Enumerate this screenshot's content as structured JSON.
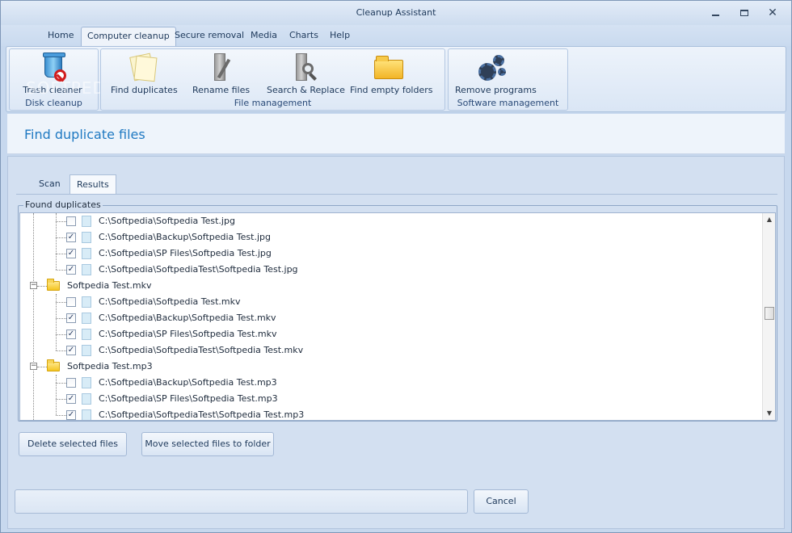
{
  "window": {
    "title": "Cleanup Assistant",
    "minimize_label": "",
    "maximize_label": "",
    "close_label": "✕"
  },
  "menu_tabs": [
    "Home",
    "Computer cleanup",
    "Secure removal",
    "Media",
    "Charts",
    "Help"
  ],
  "active_menu_tab": "Computer cleanup",
  "ribbon": {
    "disk_cleanup": {
      "label": "Disk cleanup",
      "buttons": [
        {
          "label": "Trash cleaner",
          "icon": "trash-can-icon"
        }
      ]
    },
    "file_management": {
      "label": "File management",
      "buttons": [
        {
          "label": "Find duplicates",
          "icon": "duplicate-papers-icon"
        },
        {
          "label": "Rename files",
          "icon": "rename-pen-icon"
        },
        {
          "label": "Search & Replace",
          "icon": "search-replace-icon"
        },
        {
          "label": "Find empty folders",
          "icon": "empty-folder-icon"
        }
      ]
    },
    "software_management": {
      "label": "Software management",
      "buttons": [
        {
          "label": "Remove programs",
          "icon": "gears-icon"
        }
      ]
    },
    "watermark": "SOFTPEDIA"
  },
  "page": {
    "title": "Find duplicate files"
  },
  "sub_tabs": [
    "Scan",
    "Results"
  ],
  "active_sub_tab": "Results",
  "found_duplicates": {
    "legend": "Found duplicates",
    "rows": [
      {
        "kind": "file",
        "checked": false,
        "path": "C:\\Softpedia\\Softpedia Test.jpg"
      },
      {
        "kind": "file",
        "checked": true,
        "path": "C:\\Softpedia\\Backup\\Softpedia Test.jpg"
      },
      {
        "kind": "file",
        "checked": true,
        "path": "C:\\Softpedia\\SP Files\\Softpedia Test.jpg"
      },
      {
        "kind": "file",
        "checked": true,
        "path": "C:\\Softpedia\\SoftpediaTest\\Softpedia Test.jpg"
      },
      {
        "kind": "group",
        "name": "Softpedia Test.mkv",
        "expander": "−"
      },
      {
        "kind": "file",
        "checked": false,
        "path": "C:\\Softpedia\\Softpedia Test.mkv"
      },
      {
        "kind": "file",
        "checked": true,
        "path": "C:\\Softpedia\\Backup\\Softpedia Test.mkv"
      },
      {
        "kind": "file",
        "checked": true,
        "path": "C:\\Softpedia\\SP Files\\Softpedia Test.mkv"
      },
      {
        "kind": "file",
        "checked": true,
        "path": "C:\\Softpedia\\SoftpediaTest\\Softpedia Test.mkv"
      },
      {
        "kind": "group",
        "name": "Softpedia Test.mp3",
        "expander": "−"
      },
      {
        "kind": "file",
        "checked": false,
        "path": "C:\\Softpedia\\Backup\\Softpedia Test.mp3"
      },
      {
        "kind": "file",
        "checked": true,
        "path": "C:\\Softpedia\\SP Files\\Softpedia Test.mp3"
      },
      {
        "kind": "file",
        "checked": true,
        "path": "C:\\Softpedia\\SoftpediaTest\\Softpedia Test.mp3"
      }
    ],
    "check_glyph": "✓",
    "scroll_up_glyph": "▲",
    "scroll_down_glyph": "▼"
  },
  "actions": {
    "delete_label": "Delete selected files",
    "move_label": "Move selected files to folder",
    "cancel_label": "Cancel"
  },
  "colors": {
    "accent": "#1f79c2",
    "window_bg": "#c7d8ee"
  }
}
